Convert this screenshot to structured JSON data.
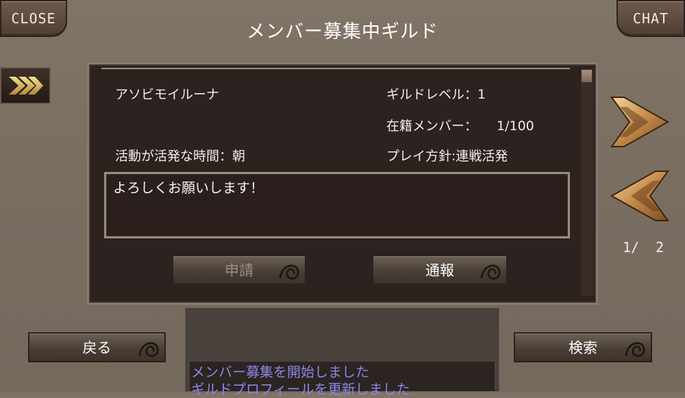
{
  "header": {
    "close_label": "CLOSE",
    "chat_label": "CHAT",
    "title": "メンバー募集中ギルド"
  },
  "guild": {
    "name": "アソビモイルーナ",
    "level_label": "ギルドレベル：",
    "level_value": "1",
    "members_label": "在籍メンバー：",
    "members_value": "1/100",
    "active_time": "活動が活発な時間：朝",
    "play_policy": "プレイ方針:連戦活発",
    "message": "よろしくお願いします！"
  },
  "actions": {
    "apply_label": "申請",
    "report_label": "通報",
    "back_label": "戻る",
    "search_label": "検索"
  },
  "pagination": {
    "current": "1",
    "total": "2",
    "display": "1/  2"
  },
  "log": {
    "lines": [
      "メンバー募集を開始しました",
      "ギルドプロフィールを更新しました"
    ]
  },
  "colors": {
    "background": "#7a6e61",
    "panel": "#2c2220",
    "log_text": "#8d86e8",
    "gold": "#c9a45a"
  },
  "icons": {
    "collapse": "double-chevron-right-icon",
    "next": "arrow-right-icon",
    "prev": "arrow-left-icon",
    "swirl": "swirl-ornament-icon"
  }
}
